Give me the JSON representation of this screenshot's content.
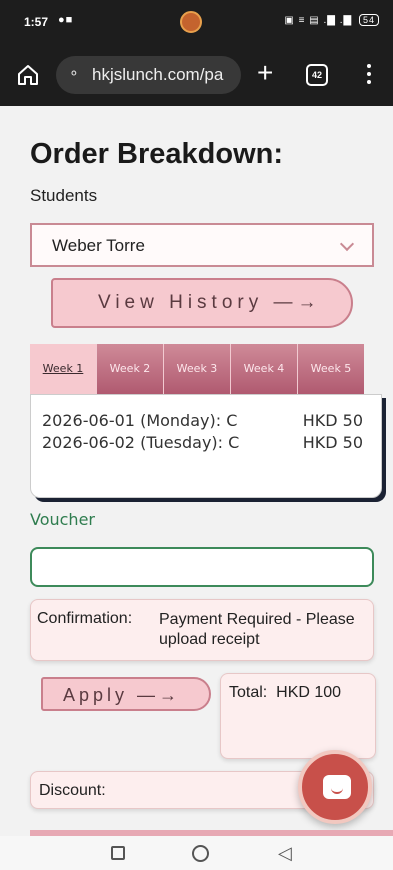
{
  "status_bar": {
    "time": "1:57",
    "left_icons": "●■",
    "right_icons": "▣ ≡ ▤ .▇ .▇",
    "battery": "54"
  },
  "browser": {
    "url": "hkjslunch.com/pa",
    "tab_count": "42",
    "icons": [
      "home-icon",
      "tune-icon",
      "plus-icon",
      "tab-switcher-icon",
      "more-vert-icon"
    ]
  },
  "page": {
    "title": "Order Breakdown:",
    "students_label": "Students",
    "selected_student": "Weber Torre",
    "view_history_label": "View History —→",
    "weeks": [
      "Week 1",
      "Week 2",
      "Week 3",
      "Week 4",
      "Week 5"
    ],
    "active_week": "Week 1",
    "orders": [
      {
        "date": "2026-06-01 (Monday): C",
        "price": "HKD 50"
      },
      {
        "date": "2026-06-02 (Tuesday): C",
        "price": "HKD 50"
      }
    ],
    "voucher_label": "Voucher",
    "voucher_value": "",
    "confirmation_label": "Confirmation:",
    "confirmation_text": "Payment Required - Please upload receipt",
    "apply_label": "Apply —→",
    "total_label": "Total:",
    "total_value": "HKD 100",
    "discount_label": "Discount:"
  },
  "colors": {
    "accent_pink": "#f6c9cf",
    "accent_green": "#3d8a5a",
    "fab": "#c8504a"
  }
}
